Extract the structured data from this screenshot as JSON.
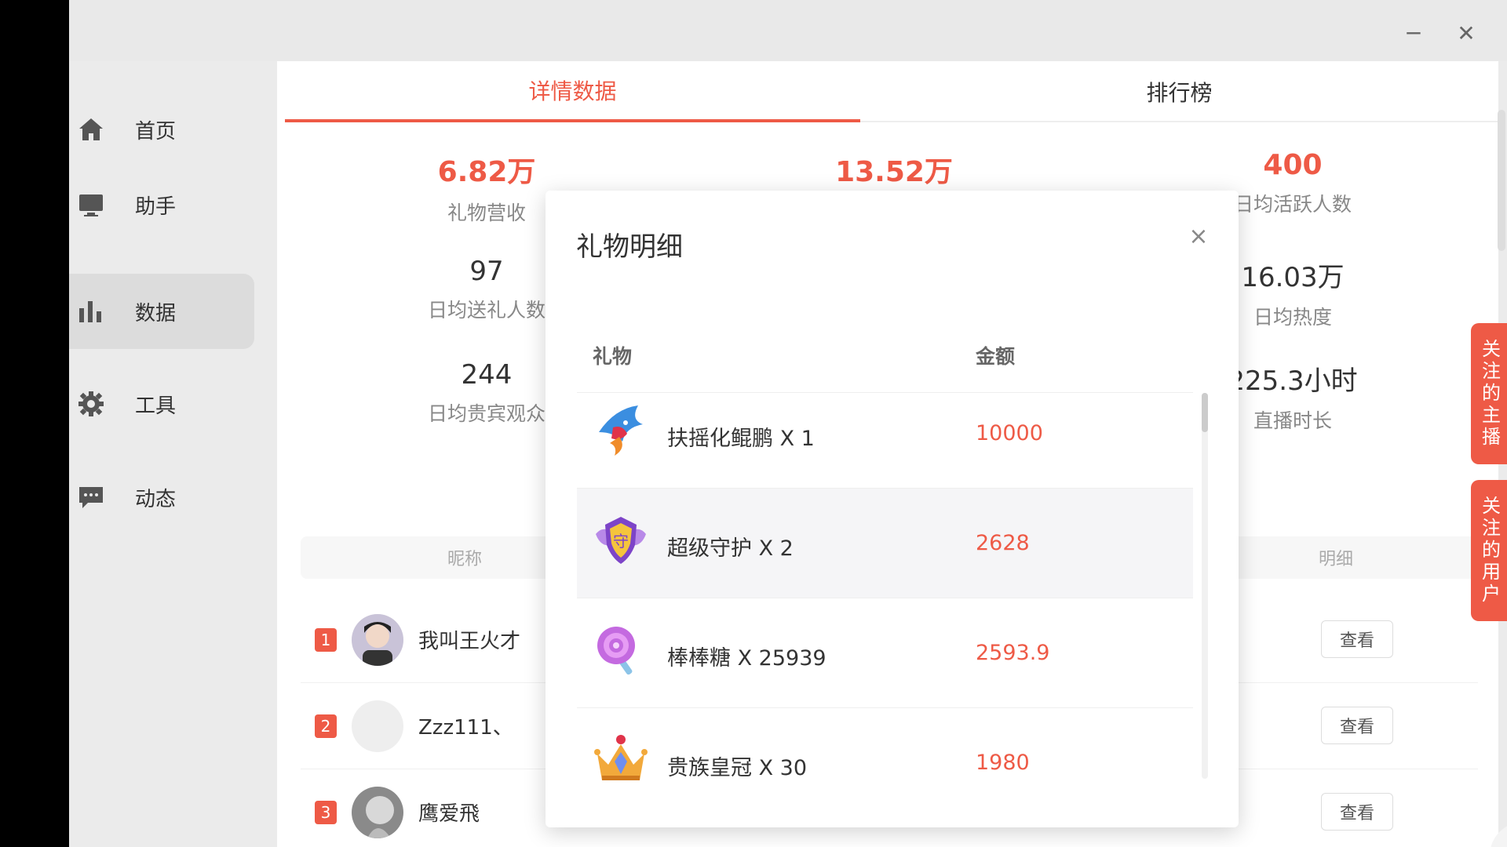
{
  "window": {
    "minimize": "─",
    "close": "✕"
  },
  "sidebar": {
    "items": [
      {
        "label": "首页",
        "icon": "home-icon"
      },
      {
        "label": "助手",
        "icon": "monitor-icon"
      },
      {
        "label": "数据",
        "icon": "bar-chart-icon",
        "active": true
      },
      {
        "label": "工具",
        "icon": "gear-icon"
      },
      {
        "label": "动态",
        "icon": "message-icon"
      }
    ]
  },
  "tabs": {
    "detail": "详情数据",
    "ranking": "排行榜"
  },
  "stats": [
    {
      "value": "6.82万",
      "label": "礼物营收"
    },
    {
      "value": "13.52万",
      "label": ""
    },
    {
      "value": "400",
      "label": "日均活跃人数"
    },
    {
      "value": "97",
      "label": "日均送礼人数"
    },
    {
      "value": "16.03万",
      "label": "日均热度"
    },
    {
      "value": "244",
      "label": "日均贵宾观众"
    },
    {
      "value": "225.3小时",
      "label": "直播时长"
    }
  ],
  "table": {
    "col_nick": "昵称",
    "col_detail": "明细",
    "view_label": "查看",
    "rows": [
      {
        "rank": "1",
        "nick": "我叫王火才"
      },
      {
        "rank": "2",
        "nick": "Zzz111、"
      },
      {
        "rank": "3",
        "nick": "鹰爱飛"
      }
    ]
  },
  "side_tabs": {
    "anchors": "关注的主播",
    "users": "关注的用户"
  },
  "modal": {
    "title": "礼物明细",
    "close": "×",
    "col_gift": "礼物",
    "col_amount": "金额",
    "gifts": [
      {
        "name": "扶摇化鲲鹏 X 1",
        "amount": "10000",
        "icon": "kunpeng-bird-icon"
      },
      {
        "name": "超级守护 X 2",
        "amount": "2628",
        "icon": "guard-shield-icon"
      },
      {
        "name": "棒棒糖 X 25939",
        "amount": "2593.9",
        "icon": "lollipop-icon"
      },
      {
        "name": "贵族皇冠 X 30",
        "amount": "1980",
        "icon": "crown-icon"
      }
    ]
  }
}
